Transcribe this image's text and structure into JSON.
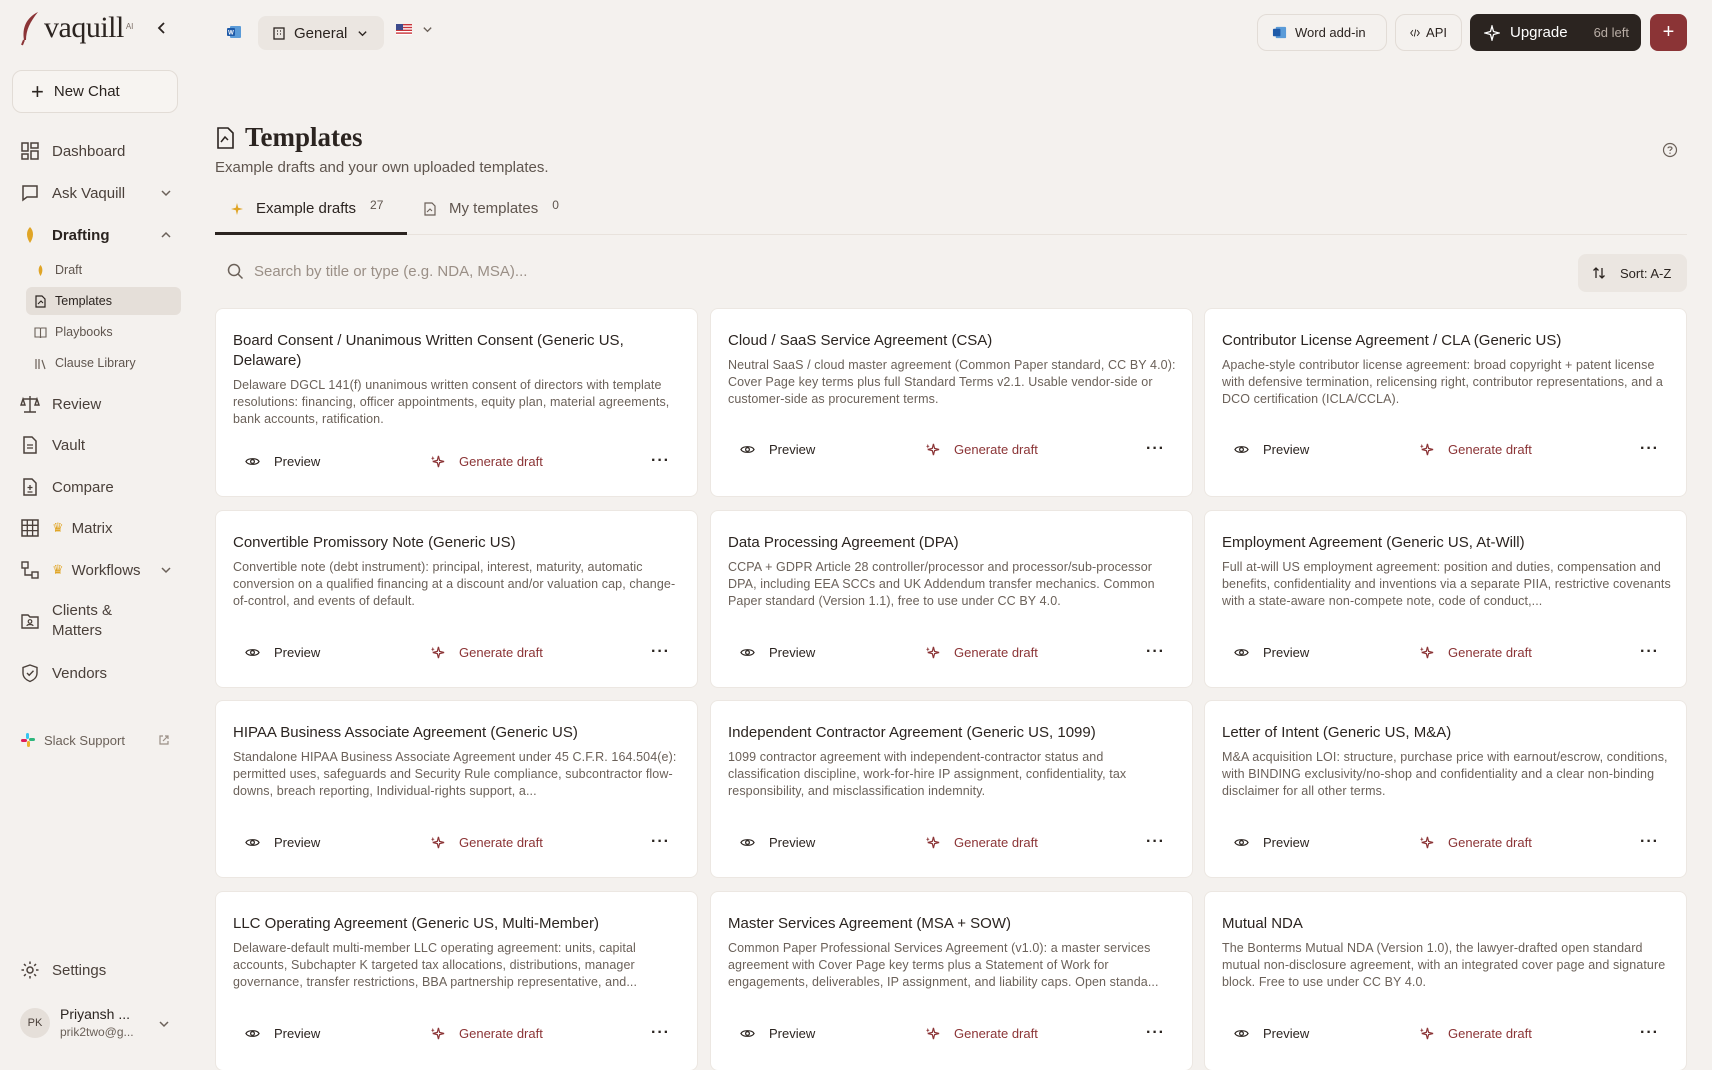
{
  "brand": {
    "name": "vaquill",
    "sup": "AI",
    "accent": "#8b3436",
    "dark": "#2b2420",
    "crown": "#e0a526"
  },
  "sidebar": {
    "new_chat": "New Chat",
    "items": [
      {
        "label": "Dashboard"
      },
      {
        "label": "Ask Vaquill"
      },
      {
        "label": "Drafting"
      },
      {
        "label": "Review"
      },
      {
        "label": "Vault"
      },
      {
        "label": "Compare"
      },
      {
        "label": "Matrix"
      },
      {
        "label": "Workflows"
      },
      {
        "label": "Clients &\nMatters"
      },
      {
        "label": "Vendors"
      }
    ],
    "drafting_sub": [
      {
        "label": "Draft"
      },
      {
        "label": "Templates"
      },
      {
        "label": "Playbooks"
      },
      {
        "label": "Clause Library"
      }
    ],
    "slack": "Slack Support",
    "settings": "Settings",
    "user": {
      "initials": "PK",
      "name": "Priyansh ...",
      "email": "prik2two@g..."
    }
  },
  "topbar": {
    "workspace": "General",
    "word_addin": "Word add-in",
    "api": "API",
    "upgrade": "Upgrade",
    "trial_left": "6d left",
    "plus": "+"
  },
  "page": {
    "title": "Templates",
    "subtitle": "Example drafts and your own uploaded templates.",
    "tabs": [
      {
        "label": "Example drafts",
        "count": "27"
      },
      {
        "label": "My templates",
        "count": "0"
      }
    ],
    "search_placeholder": "Search by title or type (e.g. NDA, MSA)...",
    "sort": "Sort: A-Z"
  },
  "actions": {
    "preview": "Preview",
    "generate": "Generate draft",
    "more": "···"
  },
  "cards": [
    {
      "title": "Board Consent / Unanimous Written Consent (Generic US, Delaware)",
      "desc": "Delaware DGCL 141(f) unanimous written consent of directors with template resolutions: financing, officer appointments, equity plan, material agreements, bank accounts, ratification."
    },
    {
      "title": "Cloud / SaaS Service Agreement (CSA)",
      "desc": "Neutral SaaS / cloud master agreement (Common Paper standard, CC BY 4.0): Cover Page key terms plus full Standard Terms v2.1. Usable vendor-side or customer-side as procurement terms."
    },
    {
      "title": "Contributor License Agreement / CLA (Generic US)",
      "desc": "Apache-style contributor license agreement: broad copyright + patent license with defensive termination, relicensing right, contributor representations, and a DCO certification (ICLA/CCLA)."
    },
    {
      "title": "Convertible Promissory Note (Generic US)",
      "desc": "Convertible note (debt instrument): principal, interest, maturity, automatic conversion on a qualified financing at a discount and/or valuation cap, change-of-control, and events of default."
    },
    {
      "title": "Data Processing Agreement (DPA)",
      "desc": "CCPA + GDPR Article 28 controller/processor and processor/sub-processor DPA, including EEA SCCs and UK Addendum transfer mechanics. Common Paper standard (Version 1.1), free to use under CC BY 4.0."
    },
    {
      "title": "Employment Agreement (Generic US, At-Will)",
      "desc": "Full at-will US employment agreement: position and duties, compensation and benefits, confidentiality and inventions via a separate PIIA, restrictive covenants with a state-aware non-compete note, code of conduct,..."
    },
    {
      "title": "HIPAA Business Associate Agreement (Generic US)",
      "desc": "Standalone HIPAA Business Associate Agreement under 45 C.F.R. 164.504(e): permitted uses, safeguards and Security Rule compliance, subcontractor flow-downs, breach reporting, Individual-rights support, a..."
    },
    {
      "title": "Independent Contractor Agreement (Generic US, 1099)",
      "desc": "1099 contractor agreement with independent-contractor status and classification discipline, work-for-hire IP assignment, confidentiality, tax responsibility, and misclassification indemnity."
    },
    {
      "title": "Letter of Intent (Generic US, M&A)",
      "desc": "M&A acquisition LOI: structure, purchase price with earnout/escrow, conditions, with BINDING exclusivity/no-shop and confidentiality and a clear non-binding disclaimer for all other terms."
    },
    {
      "title": "LLC Operating Agreement (Generic US, Multi-Member)",
      "desc": "Delaware-default multi-member LLC operating agreement: units, capital accounts, Subchapter K targeted tax allocations, distributions, manager governance, transfer restrictions, BBA partnership representative, and..."
    },
    {
      "title": "Master Services Agreement (MSA + SOW)",
      "desc": "Common Paper Professional Services Agreement (v1.0): a master services agreement with Cover Page key terms plus a Statement of Work for engagements, deliverables, IP assignment, and liability caps. Open standa..."
    },
    {
      "title": "Mutual NDA",
      "desc": "The Bonterms Mutual NDA (Version 1.0), the lawyer-drafted open standard mutual non-disclosure agreement, with an integrated cover page and signature block. Free to use under CC BY 4.0."
    }
  ]
}
